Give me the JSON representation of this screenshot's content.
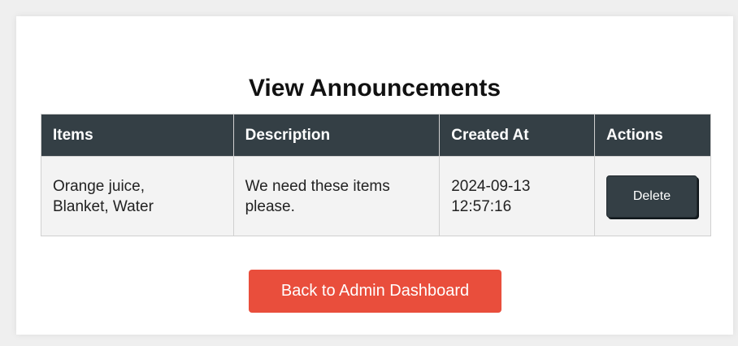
{
  "page": {
    "title": "View Announcements"
  },
  "table": {
    "headers": [
      "Items",
      "Description",
      "Created At",
      "Actions"
    ],
    "rows": [
      {
        "items": "Orange juice,\nBlanket, Water",
        "description": "We need these items\nplease.",
        "created_at": "2024-09-13\n12:57:16",
        "action_label": "Delete"
      }
    ]
  },
  "footer": {
    "back_label": "Back to Admin Dashboard"
  },
  "colors": {
    "header_bg": "#343f45",
    "row_bg": "#f3f3f3",
    "accent": "#e94e3c",
    "page_bg": "#efefef"
  }
}
